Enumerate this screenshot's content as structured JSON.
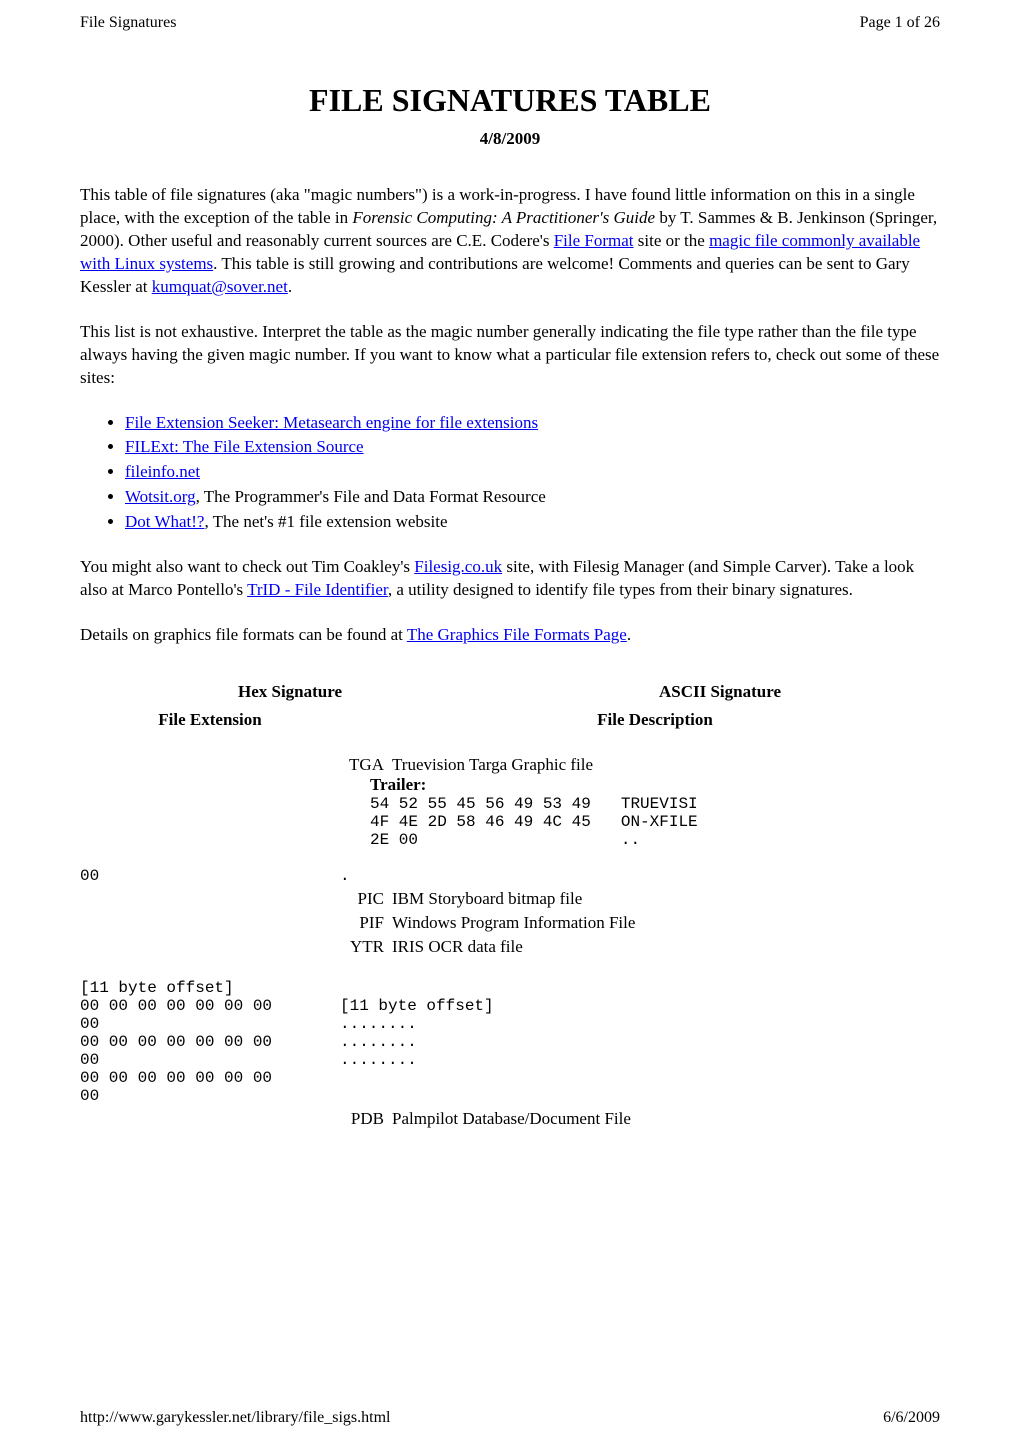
{
  "header": {
    "left": "File Signatures",
    "right": "Page 1 of 26"
  },
  "title": "FILE SIGNATURES TABLE",
  "date": "4/8/2009",
  "intro": {
    "p1a": "This table of file signatures (aka \"magic numbers\") is a work-in-progress. I have found little information on this in a single place, with the exception of the table in ",
    "p1_book": "Forensic Computing: A Practitioner's Guide",
    "p1b": " by T. Sammes & B. Jenkinson (Springer, 2000). Other useful and reasonably current sources are C.E. Codere's ",
    "p1_link1": "File Format",
    "p1c": " site or the ",
    "p1_link2": "magic file commonly available with Linux systems",
    "p1d": ". This table is still growing and contributions are welcome! Comments and queries can be sent to Gary Kessler at ",
    "p1_email": "kumquat@sover.net",
    "p1e": ".",
    "p2": "This list is not exhaustive. Interpret the table as the magic number generally indicating the file type rather than the file type always having the given magic number. If you want to know what a particular file extension refers to, check out some of these sites:",
    "links": [
      {
        "text": "File Extension Seeker: Metasearch engine for file extensions",
        "tail": ""
      },
      {
        "text": "FILExt: The File Extension Source",
        "tail": ""
      },
      {
        "text": "fileinfo.net",
        "tail": ""
      },
      {
        "text": "Wotsit.org",
        "tail": ", The Programmer's File and Data Format Resource"
      },
      {
        "text": "Dot What!?",
        "tail": ", The net's #1 file extension website"
      }
    ],
    "p3a": "You might also want to check out Tim Coakley's ",
    "p3_link1": "Filesig.co.uk",
    "p3b": " site, with Filesig Manager (and Simple Carver). Take a look also at Marco Pontello's ",
    "p3_link2": "TrID - File Identifier",
    "p3c": ", a utility designed to identify file types from their binary signatures.",
    "p4a": "Details on graphics file formats can be found at ",
    "p4_link": "The Graphics File Formats Page",
    "p4b": "."
  },
  "table": {
    "headers": {
      "hex": "Hex Signature",
      "ascii": "ASCII Signature",
      "ext": "File Extension",
      "desc": "File Description"
    },
    "tga": {
      "ext": "TGA",
      "desc": "Truevision Targa Graphic file",
      "trailer_label": "Trailer:",
      "trailer_hex": "54 52 55 45 56 49 53 49\n4F 4E 2D 58 46 49 4C 45\n2E 00",
      "trailer_ascii": "TRUEVISI\nON-XFILE\n.."
    },
    "zero": {
      "hex": "00",
      "ascii": ".",
      "rows": [
        {
          "ext": "PIC",
          "desc": "IBM Storyboard bitmap file"
        },
        {
          "ext": "PIF",
          "desc": "Windows Program Information File"
        },
        {
          "ext": "YTR",
          "desc": "IRIS OCR data file"
        }
      ]
    },
    "pdb": {
      "hex": "[11 byte offset]\n00 00 00 00 00 00 00\n00\n00 00 00 00 00 00 00\n00\n00 00 00 00 00 00 00\n00",
      "ascii": "[11 byte offset]\n........\n........\n........",
      "ext": "PDB",
      "desc": "Palmpilot Database/Document File"
    }
  },
  "footer": {
    "url": "http://www.garykessler.net/library/file_sigs.html",
    "date": "6/6/2009"
  }
}
